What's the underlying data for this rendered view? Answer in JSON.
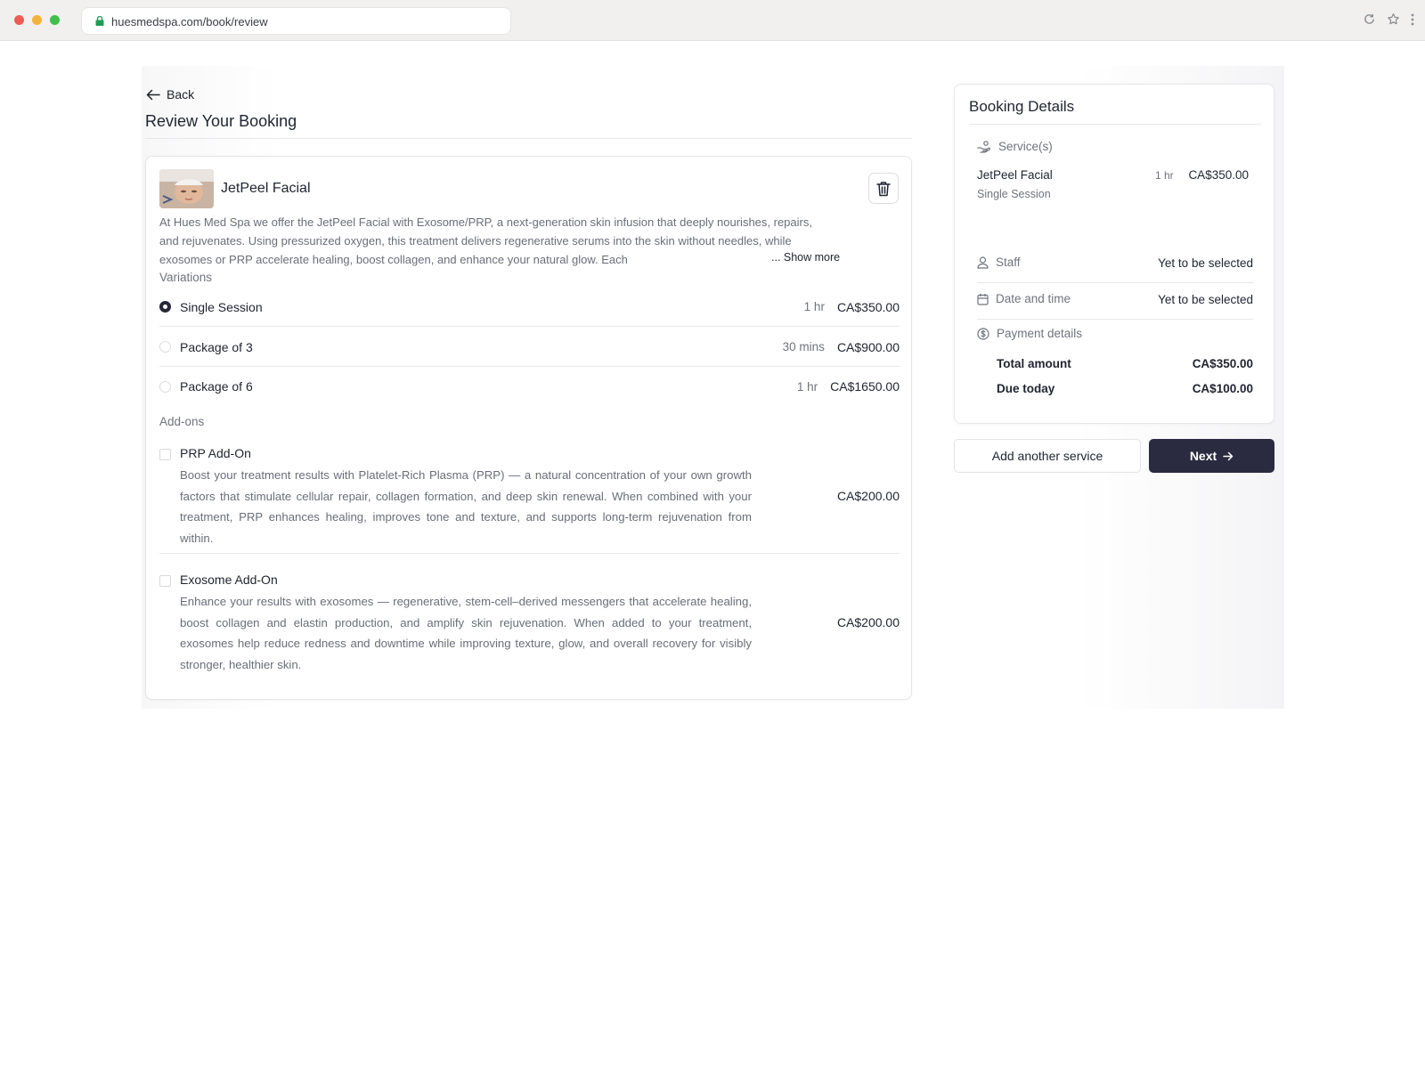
{
  "browser": {
    "url": "huesmedspa.com/book/review"
  },
  "header": {
    "back_label": "Back",
    "title": "Review Your Booking"
  },
  "service": {
    "name": "JetPeel Facial",
    "description": "At Hues Med Spa we offer the JetPeel Facial with Exosome/PRP, a next-generation skin infusion that deeply nourishes, repairs, and rejuvenates. Using pressurized oxygen, this treatment delivers regenerative serums into the skin without needles, while exosomes or PRP accelerate healing, boost collagen, and enhance your natural glow. Each",
    "show_more": "... Show more",
    "variations_label": "Variations",
    "variations": [
      {
        "name": "Single Session",
        "duration": "1 hr",
        "price": "CA$350.00",
        "selected": true
      },
      {
        "name": "Package of 3",
        "duration": "30 mins",
        "price": "CA$900.00",
        "selected": false
      },
      {
        "name": "Package of 6",
        "duration": "1 hr",
        "price": "CA$1650.00",
        "selected": false
      }
    ],
    "addons_label": "Add-ons",
    "addons": [
      {
        "name": "PRP Add-On",
        "description": "Boost your treatment results with Platelet-Rich Plasma (PRP) — a natural concentration of your own growth factors that stimulate cellular repair, collagen formation, and deep skin renewal. When combined with your treatment, PRP enhances healing, improves tone and texture, and supports long-term rejuvenation from within.",
        "price": "CA$200.00"
      },
      {
        "name": "Exosome Add-On",
        "description": "Enhance your results with exosomes — regenerative, stem-cell–derived messengers that accelerate healing, boost collagen and elastin production, and amplify skin rejuvenation. When added to your treatment, exosomes help reduce redness and downtime while improving texture, glow, and overall recovery for visibly stronger, healthier skin.",
        "price": "CA$200.00"
      }
    ]
  },
  "details": {
    "title": "Booking Details",
    "services_label": "Service(s)",
    "service_name": "JetPeel Facial",
    "service_variation": "Single Session",
    "service_duration": "1 hr",
    "service_price": "CA$350.00",
    "staff_label": "Staff",
    "staff_value": "Yet to be selected",
    "datetime_label": "Date and time",
    "datetime_value": "Yet to be selected",
    "payment_label": "Payment details",
    "total_label": "Total amount",
    "total_value": "CA$350.00",
    "due_label": "Due today",
    "due_value": "CA$100.00"
  },
  "actions": {
    "add_service": "Add another service",
    "next": "Next"
  },
  "icons": {
    "back": "arrow-left-icon",
    "delete": "trash-icon",
    "services": "hand-service-icon",
    "staff": "user-icon",
    "datetime": "calendar-icon",
    "payment": "dollar-circle-icon",
    "next": "arrow-right-icon"
  },
  "colors": {
    "primary": "#2a2a40",
    "text": "#1f2430",
    "muted": "#6f737c"
  }
}
